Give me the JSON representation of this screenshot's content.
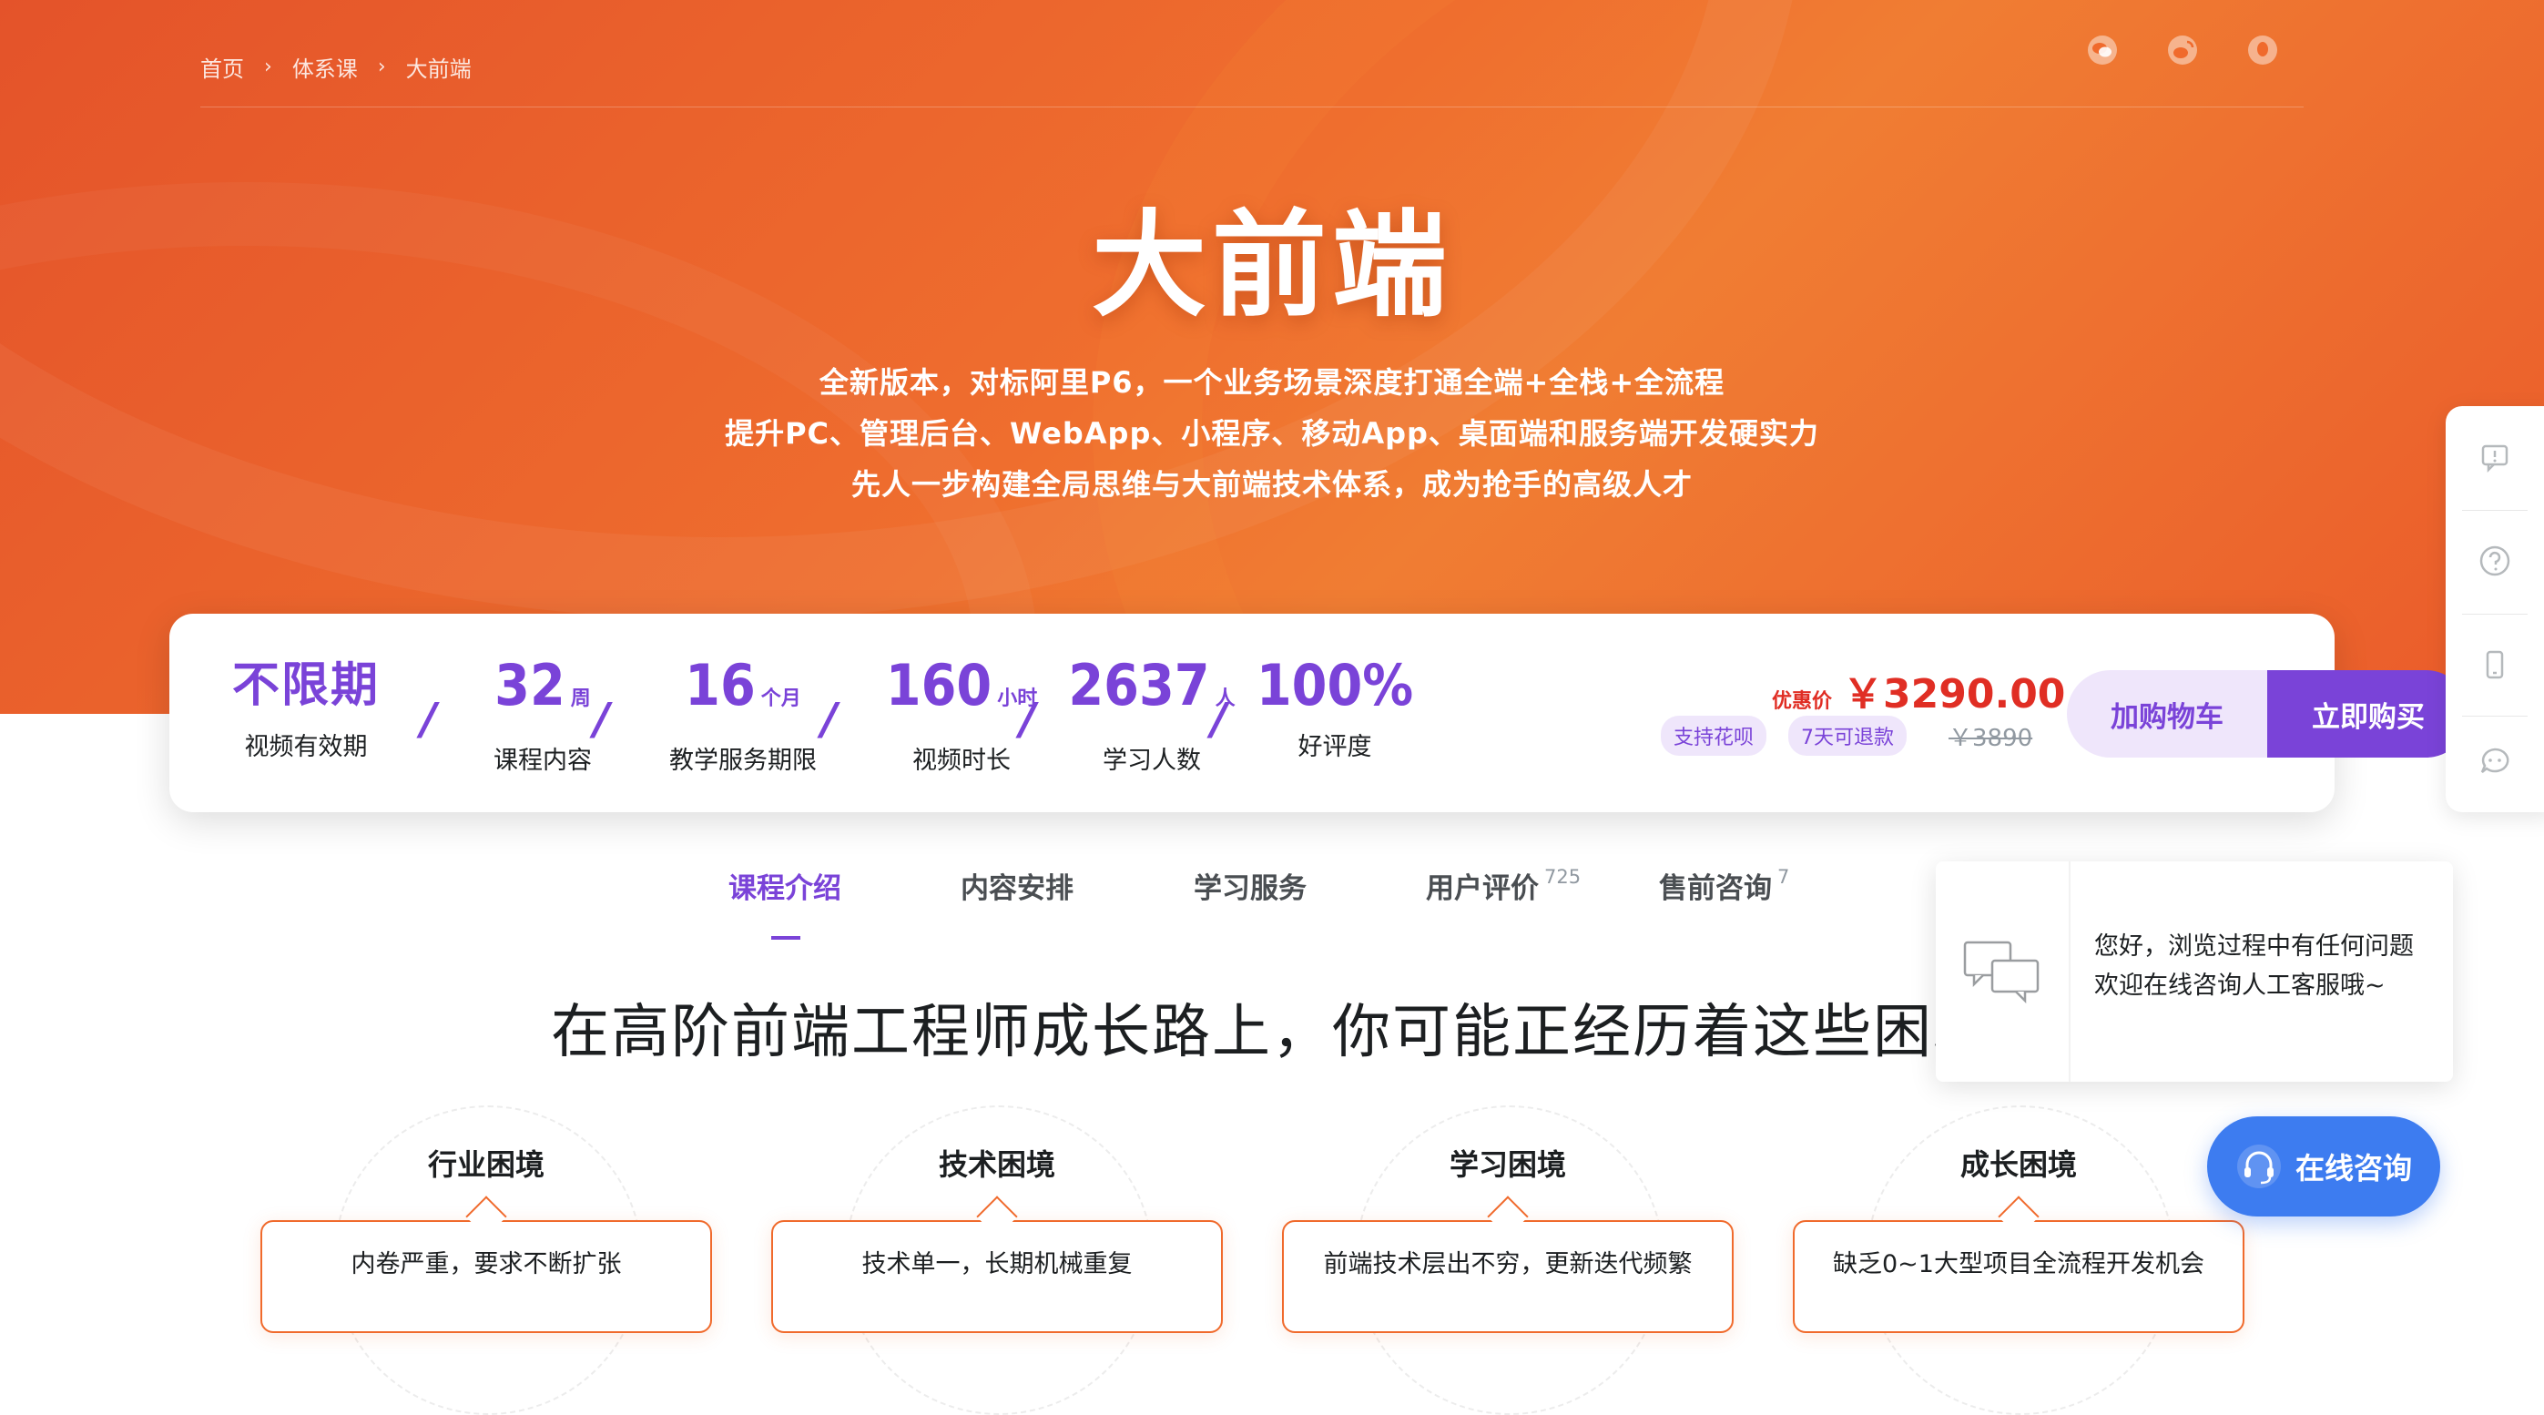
{
  "breadcrumb": {
    "home": "首页",
    "category": "体系课",
    "current": "大前端",
    "separator": "›"
  },
  "hero": {
    "title": "大前端",
    "desc_lines": [
      "全新版本，对标阿里P6，一个业务场景深度打通全端+全栈+全流程",
      "提升PC、管理后台、WebApp、小程序、移动App、桌面端和服务端开发硬实力",
      "先人一步构建全局思维与大前端技术体系，成为抢手的高级人才"
    ]
  },
  "share_icons": [
    "wechat-icon",
    "weibo-icon",
    "qq-icon"
  ],
  "stats": [
    {
      "value": "不限期",
      "unit": "",
      "label": "视频有效期"
    },
    {
      "value": "32",
      "unit": "周",
      "label": "课程内容"
    },
    {
      "value": "16",
      "unit": "个月",
      "label": "教学服务期限"
    },
    {
      "value": "160",
      "unit": "小时",
      "label": "视频时长"
    },
    {
      "value": "2637",
      "unit": "人",
      "label": "学习人数"
    },
    {
      "value": "100%",
      "unit": "",
      "label": "好评度"
    }
  ],
  "stat_separator": "/",
  "price": {
    "label": "优惠价",
    "value": "￥3290.00",
    "tags": [
      "支持花呗",
      "7天可退款"
    ],
    "original": "￥3890"
  },
  "buttons": {
    "cart": "加购物车",
    "buy": "立即购买"
  },
  "tabs": [
    {
      "label": "课程介绍",
      "count": ""
    },
    {
      "label": "内容安排",
      "count": ""
    },
    {
      "label": "学习服务",
      "count": ""
    },
    {
      "label": "用户评价",
      "count": "725"
    },
    {
      "label": "售前咨询",
      "count": "7"
    }
  ],
  "section": {
    "title": "在高阶前端工程师成长路上，你可能正经历着这些困境"
  },
  "dilemmas": [
    {
      "title": "行业困境",
      "text": "内卷严重，要求不断扩张"
    },
    {
      "title": "技术困境",
      "text": "技术单一，长期机械重复"
    },
    {
      "title": "学习困境",
      "text": "前端技术层出不穷，更新迭代频繁"
    },
    {
      "title": "成长困境",
      "text": "缺乏0~1大型项目全流程开发机会"
    }
  ],
  "sidebar_icons": [
    "feedback-icon",
    "help-icon",
    "mobile-icon",
    "chat-icon"
  ],
  "chat": {
    "message": "您好，浏览过程中有任何问题欢迎在线咨询人工客服哦~",
    "button": "在线咨询"
  },
  "colors": {
    "accent": "#7a43d8",
    "price": "#e02e24",
    "hero_start": "#e4532a",
    "hero_end": "#f07d33",
    "chat_blue": "#3d7cf0"
  }
}
